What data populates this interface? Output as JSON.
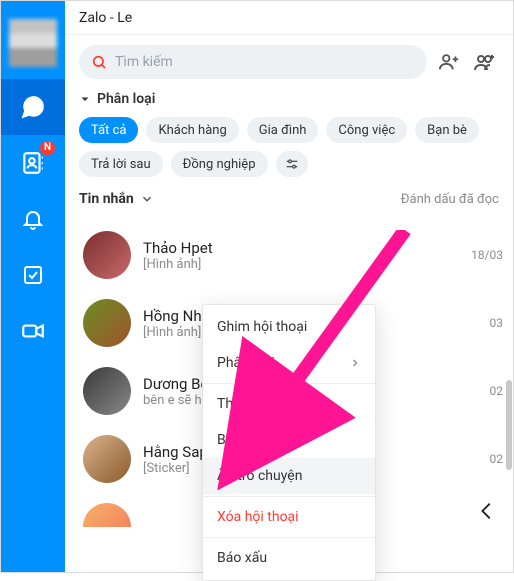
{
  "titlebar": {
    "app_and_user": "Zalo - Le"
  },
  "search": {
    "placeholder": "Tìm kiếm"
  },
  "categories": {
    "header_label": "Phân loại",
    "chips": [
      {
        "label": "Tất cả",
        "active": true
      },
      {
        "label": "Khách hàng",
        "active": false
      },
      {
        "label": "Gia đình",
        "active": false
      },
      {
        "label": "Công việc",
        "active": false
      },
      {
        "label": "Bạn bè",
        "active": false
      },
      {
        "label": "Trả lời sau",
        "active": false
      },
      {
        "label": "Đồng nghiệp",
        "active": false
      }
    ],
    "filter_icon_name": "filter-icon"
  },
  "tabs": {
    "messages_label": "Tin nhắn",
    "mark_read_label": "Đánh dấu đã đọc"
  },
  "badges": {
    "contacts_badge": "N"
  },
  "conversations": [
    {
      "name": "Thảo Hpet",
      "subtitle": "[Hình ảnh]",
      "time": "18/03"
    },
    {
      "name": "Hồng Nh",
      "subtitle": "[Hình ảnh]",
      "time": "03"
    },
    {
      "name": "Dương Bé",
      "subtitle": "bên e sẽ hỗ",
      "time": "02"
    },
    {
      "name": "Hằng Sap",
      "subtitle": "[Sticker]",
      "time": "02"
    }
  ],
  "context_menu": {
    "pin": "Ghim hội thoại",
    "categorize": "Phân loại",
    "add_to_group": "Thêm vào nhóm",
    "mute": "Bật thông báo",
    "hide": "Ẩn trò chuyện",
    "delete": "Xóa hội thoại",
    "report": "Báo xấu"
  },
  "colors": {
    "brand": "#0091ff",
    "brand_active": "#006edc",
    "danger": "#ff3b30",
    "chip_bg": "#eef1f4",
    "arrow": "#ff1493"
  }
}
